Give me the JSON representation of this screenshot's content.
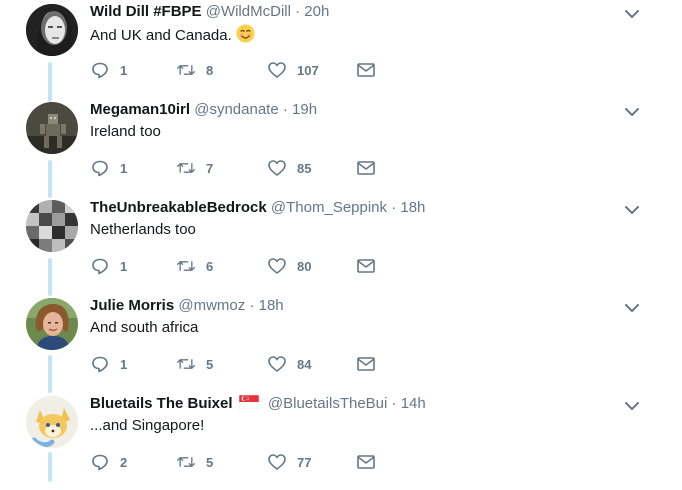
{
  "tweets": [
    {
      "name": "Wild Dill #FBPE",
      "handle": "@WildMcDill",
      "time": "20h",
      "text": "And UK and Canada.",
      "emoji": "smiling-face-emoji",
      "replies": "1",
      "retweets": "8",
      "likes": "107",
      "avatar": "grayscale-woman-portrait"
    },
    {
      "name": "Megaman10irl",
      "handle": "@syndanate",
      "time": "19h",
      "text": "Ireland too",
      "replies": "1",
      "retweets": "7",
      "likes": "85",
      "avatar": "robot-figure-dark"
    },
    {
      "name": "TheUnbreakableBedrock",
      "handle": "@Thom_Seppink",
      "time": "18h",
      "text": "Netherlands too",
      "replies": "1",
      "retweets": "6",
      "likes": "80",
      "avatar": "pixel-gray-pattern"
    },
    {
      "name": "Julie Morris",
      "handle": "@mwmoz",
      "time": "18h",
      "text": "And south africa",
      "replies": "1",
      "retweets": "5",
      "likes": "84",
      "avatar": "woman-portrait-green"
    },
    {
      "name": "Bluetails The Buixel",
      "handle": "@BluetailsTheBui",
      "time": "14h",
      "text": "...and Singapore!",
      "flag": "singapore-flag",
      "replies": "2",
      "retweets": "5",
      "likes": "77",
      "avatar": "cartoon-fox-character"
    }
  ],
  "separator": "·",
  "colors": {
    "name": "#14171a",
    "secondary": "#657786",
    "thread": "#c4e4f4",
    "icon": "#657786"
  }
}
